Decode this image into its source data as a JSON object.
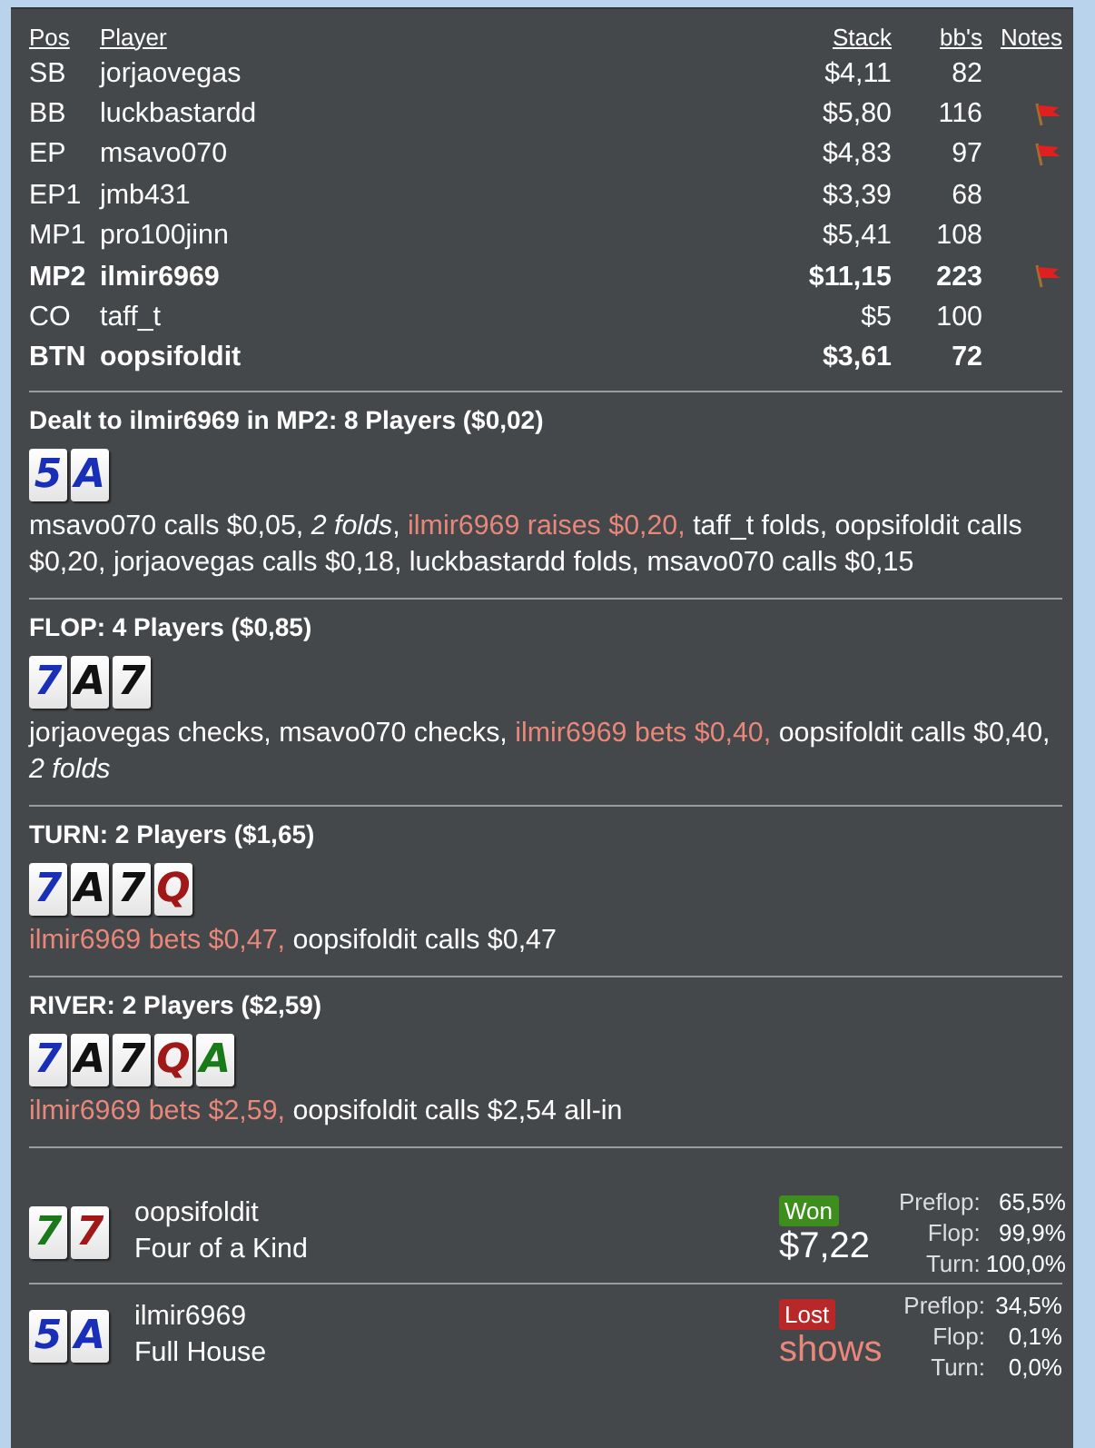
{
  "players": {
    "columns": [
      "Pos",
      "Player",
      "Stack",
      "bb's",
      "Notes"
    ],
    "rows": [
      {
        "pos": "SB",
        "player": "jorjaovegas",
        "stack": "$4,11",
        "bbs": "82",
        "bold": false,
        "flag": false
      },
      {
        "pos": "BB",
        "player": "luckbastardd",
        "stack": "$5,80",
        "bbs": "116",
        "bold": false,
        "flag": true
      },
      {
        "pos": "EP",
        "player": "msavo070",
        "stack": "$4,83",
        "bbs": "97",
        "bold": false,
        "flag": true
      },
      {
        "pos": "EP1",
        "player": "jmb431",
        "stack": "$3,39",
        "bbs": "68",
        "bold": false,
        "flag": false
      },
      {
        "pos": "MP1",
        "player": "pro100jinn",
        "stack": "$5,41",
        "bbs": "108",
        "bold": false,
        "flag": false
      },
      {
        "pos": "MP2",
        "player": "ilmir6969",
        "stack": "$11,15",
        "bbs": "223",
        "bold": true,
        "flag": true
      },
      {
        "pos": "CO",
        "player": "taff_t",
        "stack": "$5",
        "bbs": "100",
        "bold": false,
        "flag": false
      },
      {
        "pos": "BTN",
        "player": "oopsifoldit",
        "stack": "$3,61",
        "bbs": "72",
        "bold": true,
        "flag": false
      }
    ]
  },
  "streets": [
    {
      "title": "Dealt to ilmir6969 in MP2: 8 Players ($0,02)",
      "cards": [
        {
          "rank": "5",
          "color": "#1a2fb8"
        },
        {
          "rank": "A",
          "color": "#1a2fb8"
        }
      ],
      "actions": [
        {
          "kind": "plain",
          "text": "msavo070 calls $0,05, "
        },
        {
          "kind": "italic",
          "text": "2 folds"
        },
        {
          "kind": "plain",
          "text": ", "
        },
        {
          "kind": "hero",
          "text": "ilmir6969 raises $0,20, "
        },
        {
          "kind": "plain",
          "text": "taff_t folds, oopsifoldit calls $0,20, jorjaovegas calls $0,18, luckbastardd folds, msavo070 calls $0,15"
        }
      ]
    },
    {
      "title": "FLOP: 4 Players ($0,85)",
      "cards": [
        {
          "rank": "7",
          "color": "#1a2fb8"
        },
        {
          "rank": "A",
          "color": "#111111"
        },
        {
          "rank": "7",
          "color": "#111111"
        }
      ],
      "actions": [
        {
          "kind": "plain",
          "text": "jorjaovegas checks, msavo070 checks, "
        },
        {
          "kind": "hero",
          "text": "ilmir6969 bets $0,40, "
        },
        {
          "kind": "plain",
          "text": "oopsifoldit calls $0,40, "
        },
        {
          "kind": "italic",
          "text": "2 folds"
        }
      ]
    },
    {
      "title": "TURN: 2 Players ($1,65)",
      "cards": [
        {
          "rank": "7",
          "color": "#1a2fb8"
        },
        {
          "rank": "A",
          "color": "#111111"
        },
        {
          "rank": "7",
          "color": "#111111"
        },
        {
          "rank": "Q",
          "color": "#a01818"
        }
      ],
      "actions": [
        {
          "kind": "hero",
          "text": "ilmir6969 bets $0,47, "
        },
        {
          "kind": "plain",
          "text": "oopsifoldit calls $0,47"
        }
      ]
    },
    {
      "title": "RIVER: 2 Players ($2,59)",
      "cards": [
        {
          "rank": "7",
          "color": "#1a2fb8"
        },
        {
          "rank": "A",
          "color": "#111111"
        },
        {
          "rank": "7",
          "color": "#111111"
        },
        {
          "rank": "Q",
          "color": "#a01818"
        },
        {
          "rank": "A",
          "color": "#1a7a1a"
        }
      ],
      "actions": [
        {
          "kind": "hero",
          "text": "ilmir6969 bets $2,59, "
        },
        {
          "kind": "plain",
          "text": "oopsifoldit calls $2,54 all-in"
        }
      ]
    }
  ],
  "results": [
    {
      "cards": [
        {
          "rank": "7",
          "color": "#1a7a1a"
        },
        {
          "rank": "7",
          "color": "#a01818"
        }
      ],
      "player": "oopsifoldit",
      "hand": "Four of a Kind",
      "kind": "won",
      "badge": "Won",
      "amount": "$7,22",
      "equity": [
        {
          "label": "Preflop:",
          "value": "65,5%"
        },
        {
          "label": "Flop:",
          "value": "99,9%"
        },
        {
          "label": "Turn:",
          "value": "100,0%"
        }
      ]
    },
    {
      "cards": [
        {
          "rank": "5",
          "color": "#1a2fb8"
        },
        {
          "rank": "A",
          "color": "#1a2fb8"
        }
      ],
      "player": "ilmir6969",
      "hand": "Full House",
      "kind": "lost",
      "badge": "Lost",
      "amount": "shows",
      "equity": [
        {
          "label": "Preflop:",
          "value": "34,5%"
        },
        {
          "label": "Flop:",
          "value": "0,1%"
        },
        {
          "label": "Turn:",
          "value": "0,0%"
        }
      ]
    }
  ]
}
